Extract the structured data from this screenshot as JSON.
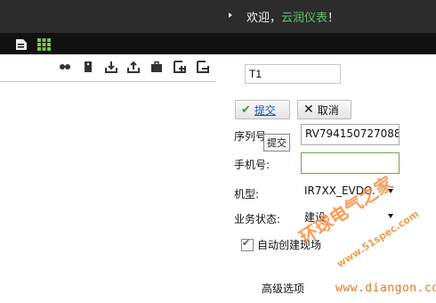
{
  "header": {
    "welcome_prefix": "欢迎，",
    "user_name": "云润仪表",
    "welcome_suffix": "！"
  },
  "nav_icons": [
    "document-icon",
    "grid-icon"
  ],
  "toolbar_icons": [
    "link-icon",
    "tag-icon",
    "download-icon",
    "upload-icon",
    "briefcase-icon",
    "add-icon",
    "remove-icon"
  ],
  "form": {
    "name_value": "T1",
    "submit_label": "提交",
    "cancel_label": "取消",
    "tooltip": "提交",
    "serial_label": "序列号:",
    "serial_value": "RV794150727088",
    "phone_label": "手机号:",
    "phone_value": "",
    "model_label": "机型:",
    "model_value": "IR7XX_EVDO.",
    "status_label": "业务状态:",
    "status_value": "建设",
    "auto_create_label": "自动创建现场",
    "auto_create_checked": true,
    "advanced_label": "高级选项"
  },
  "watermark": {
    "brand": "环球电气之家",
    "url1": "www.51spec.com",
    "url2": "www.diangon.com"
  },
  "colors": {
    "header_bg": "#2c2c2c",
    "iconbar_bg": "#111111",
    "user_name": "#5cc36b",
    "grid_icon": "#7ec63a"
  }
}
